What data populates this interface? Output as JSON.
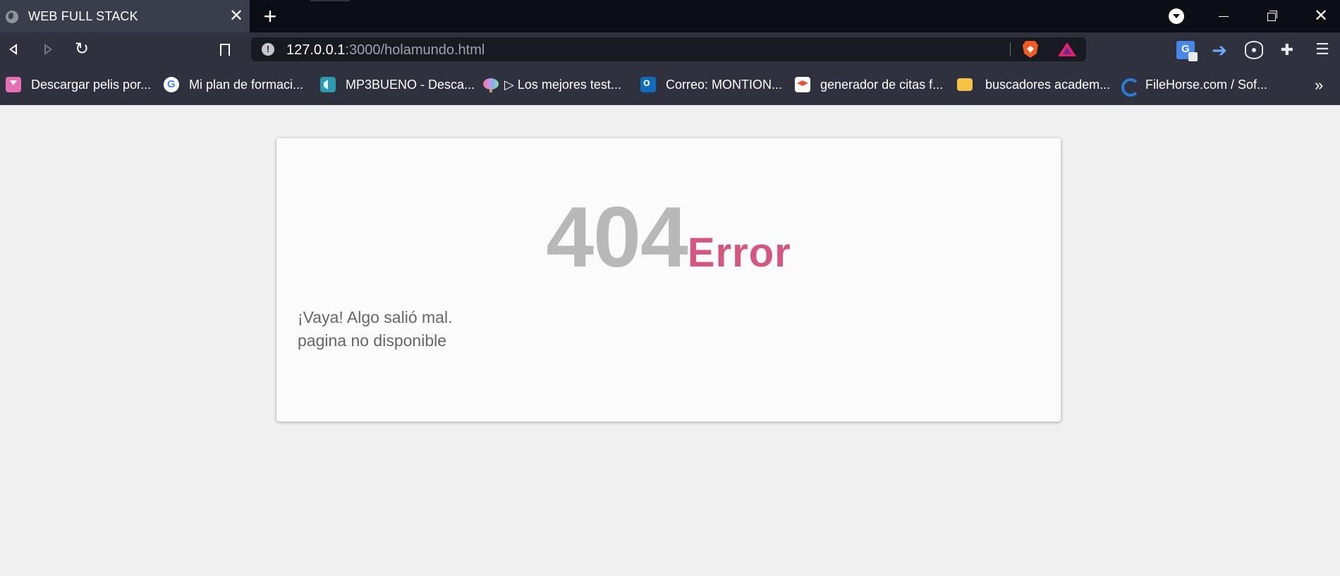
{
  "browser": {
    "tab": {
      "title": "WEB FULL STACK",
      "close": "✕"
    },
    "new_tab": "+",
    "window": {
      "close": "✕"
    },
    "address": {
      "host": "127.0.0.1",
      "path": ":3000/holamundo.html"
    },
    "toolbar": {
      "reload": "↻"
    },
    "extensions": {
      "translate": "G",
      "arrow": "➔",
      "puzzle": "✚",
      "menu": "☰"
    },
    "bookmarks": [
      {
        "label": "Descargar pelis por...",
        "icon": "download-icon"
      },
      {
        "label": "Mi plan de formaci...",
        "icon": "google-icon"
      },
      {
        "label": "MP3BUENO - Desca...",
        "icon": "mp3-icon"
      },
      {
        "label": "▷ Los mejores test...",
        "icon": "brain-icon"
      },
      {
        "label": "Correo: MONTION...",
        "icon": "outlook-icon"
      },
      {
        "label": "generador de citas f...",
        "icon": "graduation-cap-icon"
      },
      {
        "label": "buscadores academ...",
        "icon": "folder-icon"
      },
      {
        "label": "FileHorse.com / Sof...",
        "icon": "filehorse-icon"
      }
    ],
    "bookmarks_more": "»"
  },
  "page": {
    "code": "404",
    "error_word": "Error",
    "message_line1": "¡Vaya! Algo salió mal.",
    "message_line2": "pagina no disponible",
    "colors": {
      "code": "#b8b8b8",
      "error_word": "#d4577f",
      "message": "#666666",
      "background": "#f0f0f0",
      "card": "#fbfbfb"
    }
  }
}
